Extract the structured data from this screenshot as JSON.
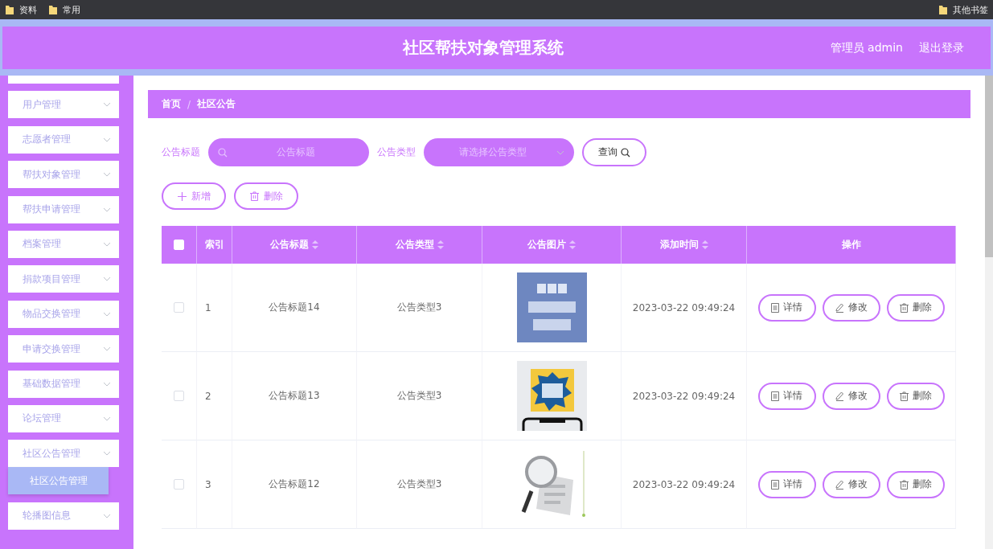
{
  "bookmarks": [
    {
      "label": "资料"
    },
    {
      "label": "常用"
    }
  ],
  "bookmarks_right": [
    {
      "label": "其他书签"
    }
  ],
  "header": {
    "title": "社区帮扶对象管理系统",
    "user": "管理员 admin",
    "logout": "退出登录"
  },
  "sidebar": {
    "items": [
      {
        "label": "用户管理"
      },
      {
        "label": "志愿者管理"
      },
      {
        "label": "帮扶对象管理"
      },
      {
        "label": "帮扶申请管理"
      },
      {
        "label": "档案管理"
      },
      {
        "label": "捐款项目管理"
      },
      {
        "label": "物品交换管理"
      },
      {
        "label": "申请交换管理"
      },
      {
        "label": "基础数据管理"
      },
      {
        "label": "论坛管理"
      },
      {
        "label": "社区公告管理",
        "children": [
          {
            "label": "社区公告管理",
            "selected": true
          }
        ]
      },
      {
        "label": "轮播图信息"
      }
    ]
  },
  "breadcrumb": {
    "separator": "/",
    "items": [
      "首页",
      "社区公告"
    ]
  },
  "search": {
    "fields": [
      {
        "kind": "text",
        "label": "公告标题",
        "placeholder": "公告标题"
      },
      {
        "kind": "select",
        "label": "公告类型",
        "placeholder": "请选择公告类型"
      }
    ],
    "button": "查询"
  },
  "toolbar": [
    {
      "kind": "add",
      "label": "新增"
    },
    {
      "kind": "delete",
      "label": "删除"
    }
  ],
  "table": {
    "select_all": {
      "checked": false
    },
    "columns": [
      {
        "label": "索引",
        "sortable": false
      },
      {
        "label": "公告标题",
        "sortable": true
      },
      {
        "label": "公告类型",
        "sortable": true
      },
      {
        "label": "公告图片",
        "sortable": true
      },
      {
        "label": "添加时间",
        "sortable": true
      },
      {
        "label": "操作",
        "sortable": false
      }
    ],
    "rows": [
      {
        "checked": false,
        "index": "1",
        "title": "公告标题14",
        "type": "公告类型3",
        "time": "2023-03-22 09:49:24",
        "actions": [
          {
            "kind": "detail",
            "label": "详情"
          },
          {
            "kind": "edit",
            "label": "修改"
          },
          {
            "kind": "delete",
            "label": "删除"
          }
        ]
      },
      {
        "checked": false,
        "index": "2",
        "title": "公告标题13",
        "type": "公告类型3",
        "time": "2023-03-22 09:49:24",
        "actions": [
          {
            "kind": "detail",
            "label": "详情"
          },
          {
            "kind": "edit",
            "label": "修改"
          },
          {
            "kind": "delete",
            "label": "删除"
          }
        ]
      },
      {
        "checked": false,
        "index": "3",
        "title": "公告标题12",
        "type": "公告类型3",
        "time": "2023-03-22 09:49:24",
        "actions": [
          {
            "kind": "detail",
            "label": "详情"
          },
          {
            "kind": "edit",
            "label": "修改"
          },
          {
            "kind": "delete",
            "label": "删除"
          }
        ]
      }
    ]
  }
}
